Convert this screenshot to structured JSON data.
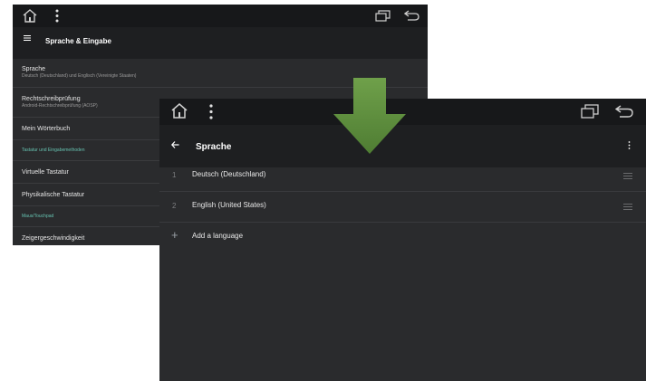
{
  "back_screen": {
    "toolbar_title": "Sprache & Eingabe",
    "items": [
      {
        "kind": "pref",
        "title": "Sprache",
        "summary": "Deutsch (Deutschland) und Englisch (Vereinigte Staaten)"
      },
      {
        "kind": "pref",
        "title": "Rechtschreibprüfung",
        "summary": "Android-Rechtschreibprüfung (AOSP)"
      },
      {
        "kind": "pref",
        "title": "Mein Wörterbuch",
        "summary": ""
      },
      {
        "kind": "section",
        "title": "Tastatur und Eingabemethoden"
      },
      {
        "kind": "pref",
        "title": "Virtuelle Tastatur",
        "summary": ""
      },
      {
        "kind": "pref",
        "title": "Physikalische Tastatur",
        "summary": ""
      },
      {
        "kind": "section",
        "title": "Maus/Touchpad"
      },
      {
        "kind": "pref",
        "title": "Zeigergeschwindigkeit",
        "summary": ""
      }
    ]
  },
  "front_screen": {
    "toolbar_title": "Sprache",
    "languages": [
      {
        "number": "1",
        "name": "Deutsch (Deutschland)"
      },
      {
        "number": "2",
        "name": "English (United States)"
      }
    ],
    "add_language_label": "Add a language"
  },
  "colors": {
    "screen_bg": "#2a2b2d",
    "navbar_bg": "#17181a",
    "toolbar_bg": "#1e1f21",
    "section_accent": "#66c2b0",
    "arrow_green": "#5b8a3a"
  }
}
